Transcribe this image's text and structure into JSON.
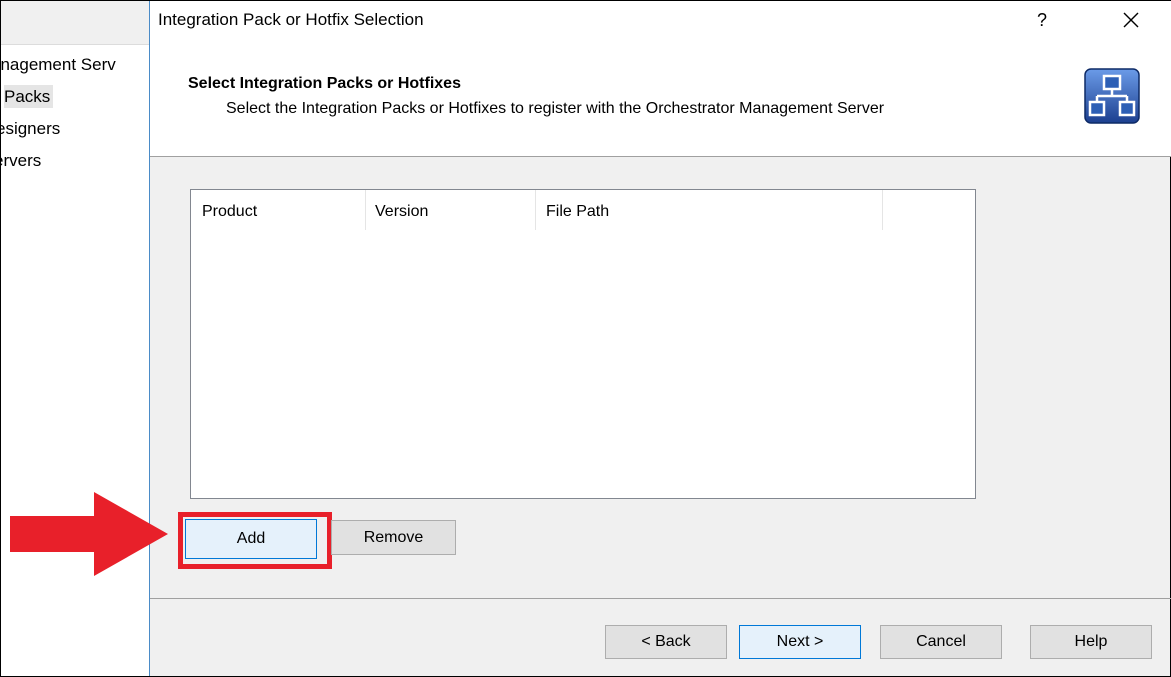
{
  "background_window": {
    "tree_items": [
      "anagement Serv",
      "Packs",
      "esigners",
      "ervers"
    ]
  },
  "dialog": {
    "title": "Integration Pack or Hotfix Selection",
    "help_glyph": "?",
    "close_icon": "close-icon",
    "header": {
      "title": "Select Integration Packs or Hotfixes",
      "subtitle": "Select the Integration Packs or Hotfixes to register with the Orchestrator Management Server",
      "icon": "network-hierarchy-icon"
    },
    "list": {
      "columns": [
        "Product",
        "Version",
        "File Path"
      ],
      "rows": []
    },
    "buttons": {
      "add": "Add",
      "remove": "Remove",
      "back": "< Back",
      "next": "Next >",
      "cancel": "Cancel",
      "help": "Help"
    }
  },
  "annotation": {
    "arrow_color": "#e8202a",
    "highlight_color": "#e8202a"
  },
  "colors": {
    "dialog_bg": "#f0f0f0",
    "accent": "#0078d7",
    "icon_blue": "#2d5fb5"
  }
}
